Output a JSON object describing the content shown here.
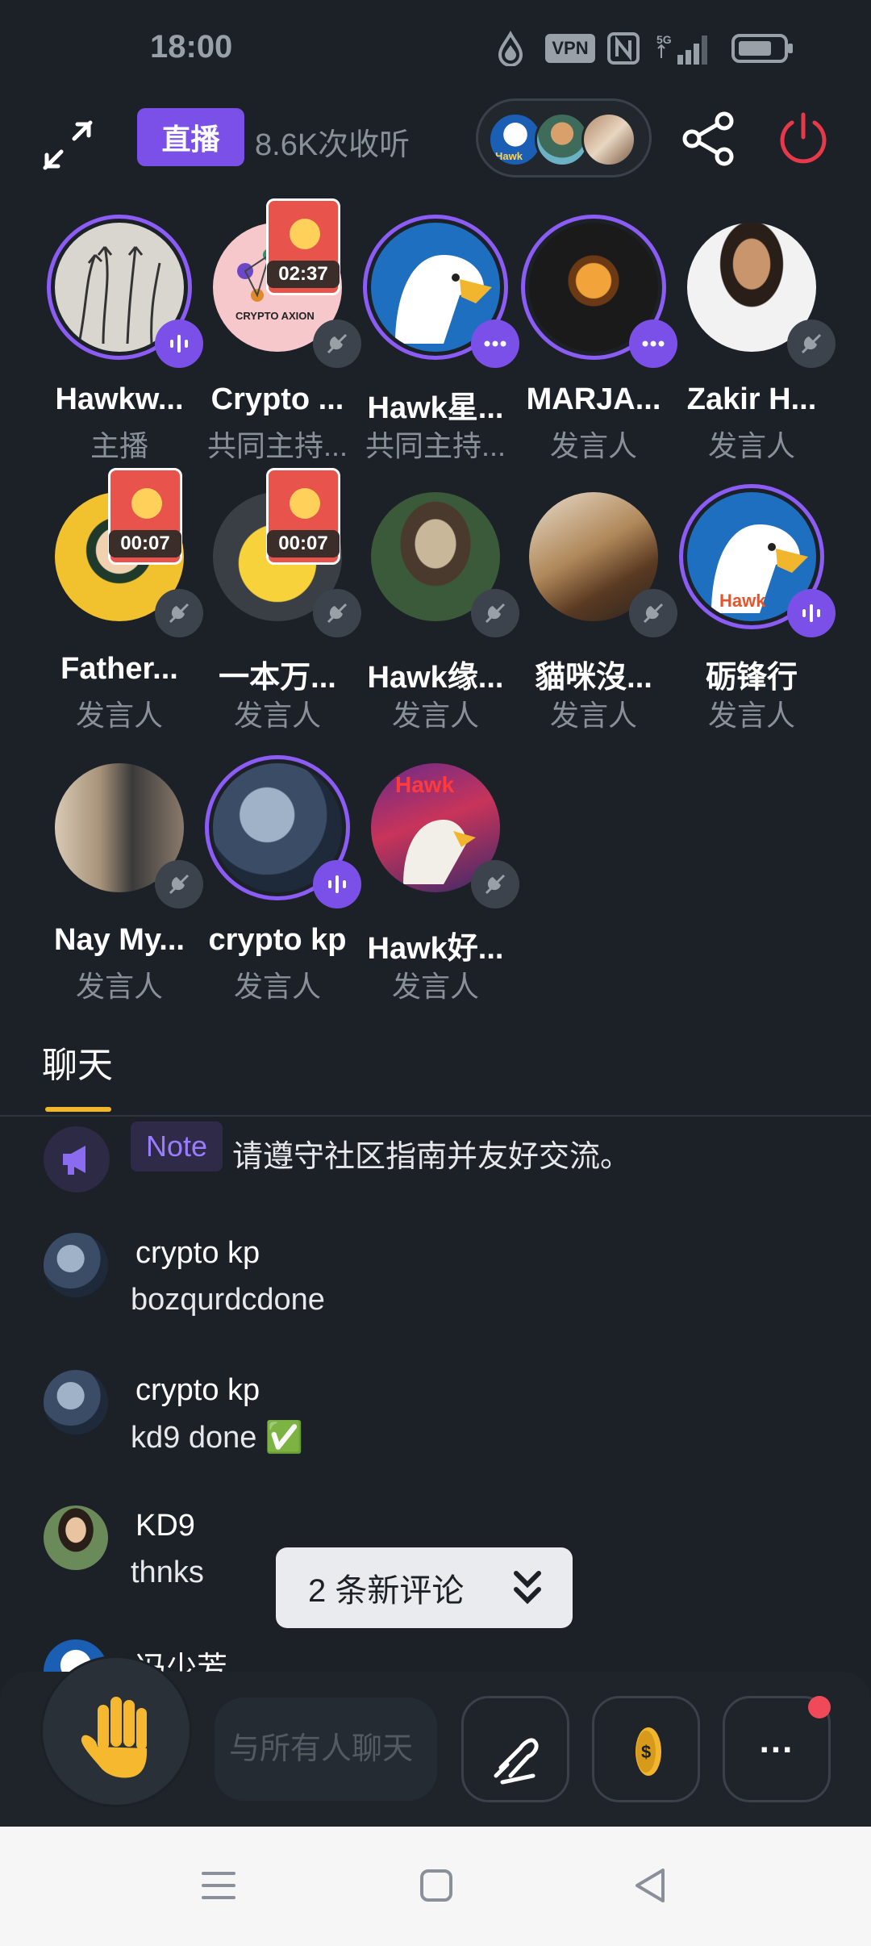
{
  "status_bar": {
    "time": "18:00",
    "vpn": "VPN",
    "network": "5G"
  },
  "header": {
    "live_label": "直播",
    "listen_count": "8.6K次收听",
    "avatar_logo_text": "Hawk"
  },
  "speakers": [
    {
      "name": "Hawkw...",
      "role": "主播",
      "badge": "talking"
    },
    {
      "name": "Crypto ...",
      "role": "共同主持...",
      "badge": "muted",
      "timer": "02:37",
      "avatar_text": "CRYPTO AXION"
    },
    {
      "name": "Hawk星...",
      "role": "共同主持...",
      "badge": "more"
    },
    {
      "name": "MARJA...",
      "role": "发言人",
      "badge": "more"
    },
    {
      "name": "Zakir H...",
      "role": "发言人",
      "badge": "muted"
    },
    {
      "name": "Father...",
      "role": "发言人",
      "badge": "muted",
      "timer": "00:07"
    },
    {
      "name": "一本万...",
      "role": "发言人",
      "badge": "muted",
      "timer": "00:07"
    },
    {
      "name": "Hawk缘...",
      "role": "发言人",
      "badge": "muted"
    },
    {
      "name": "貓咪沒...",
      "role": "发言人",
      "badge": "muted"
    },
    {
      "name": "砺锋行",
      "role": "发言人",
      "badge": "talking",
      "avatar_text": "Hawk"
    },
    {
      "name": "Nay My...",
      "role": "发言人",
      "badge": "muted"
    },
    {
      "name": "crypto kp",
      "role": "发言人",
      "badge": "talking"
    },
    {
      "name": "Hawk好...",
      "role": "发言人",
      "badge": "muted",
      "avatar_text": "Hawk"
    }
  ],
  "chat": {
    "tab_label": "聊天",
    "note_tag": "Note",
    "note_text": "请遵守社区指南并友好交流。",
    "messages": [
      {
        "user": "crypto kp",
        "text": "bozqurdcdone"
      },
      {
        "user": "crypto kp",
        "text": "kd9 done ✅"
      },
      {
        "user": "KD9",
        "text": "thnks"
      },
      {
        "user": "冯少芳",
        "text": ""
      }
    ],
    "new_comments": "2 条新评论"
  },
  "bottom_bar": {
    "chat_placeholder": "与所有人聊天",
    "more_label": "..."
  },
  "colors": {
    "background": "#1c2127",
    "accent_purple": "#7b50e8",
    "tab_underline": "#f2b62e",
    "power_red": "#e8394a",
    "notify_dot": "#f0495a"
  }
}
